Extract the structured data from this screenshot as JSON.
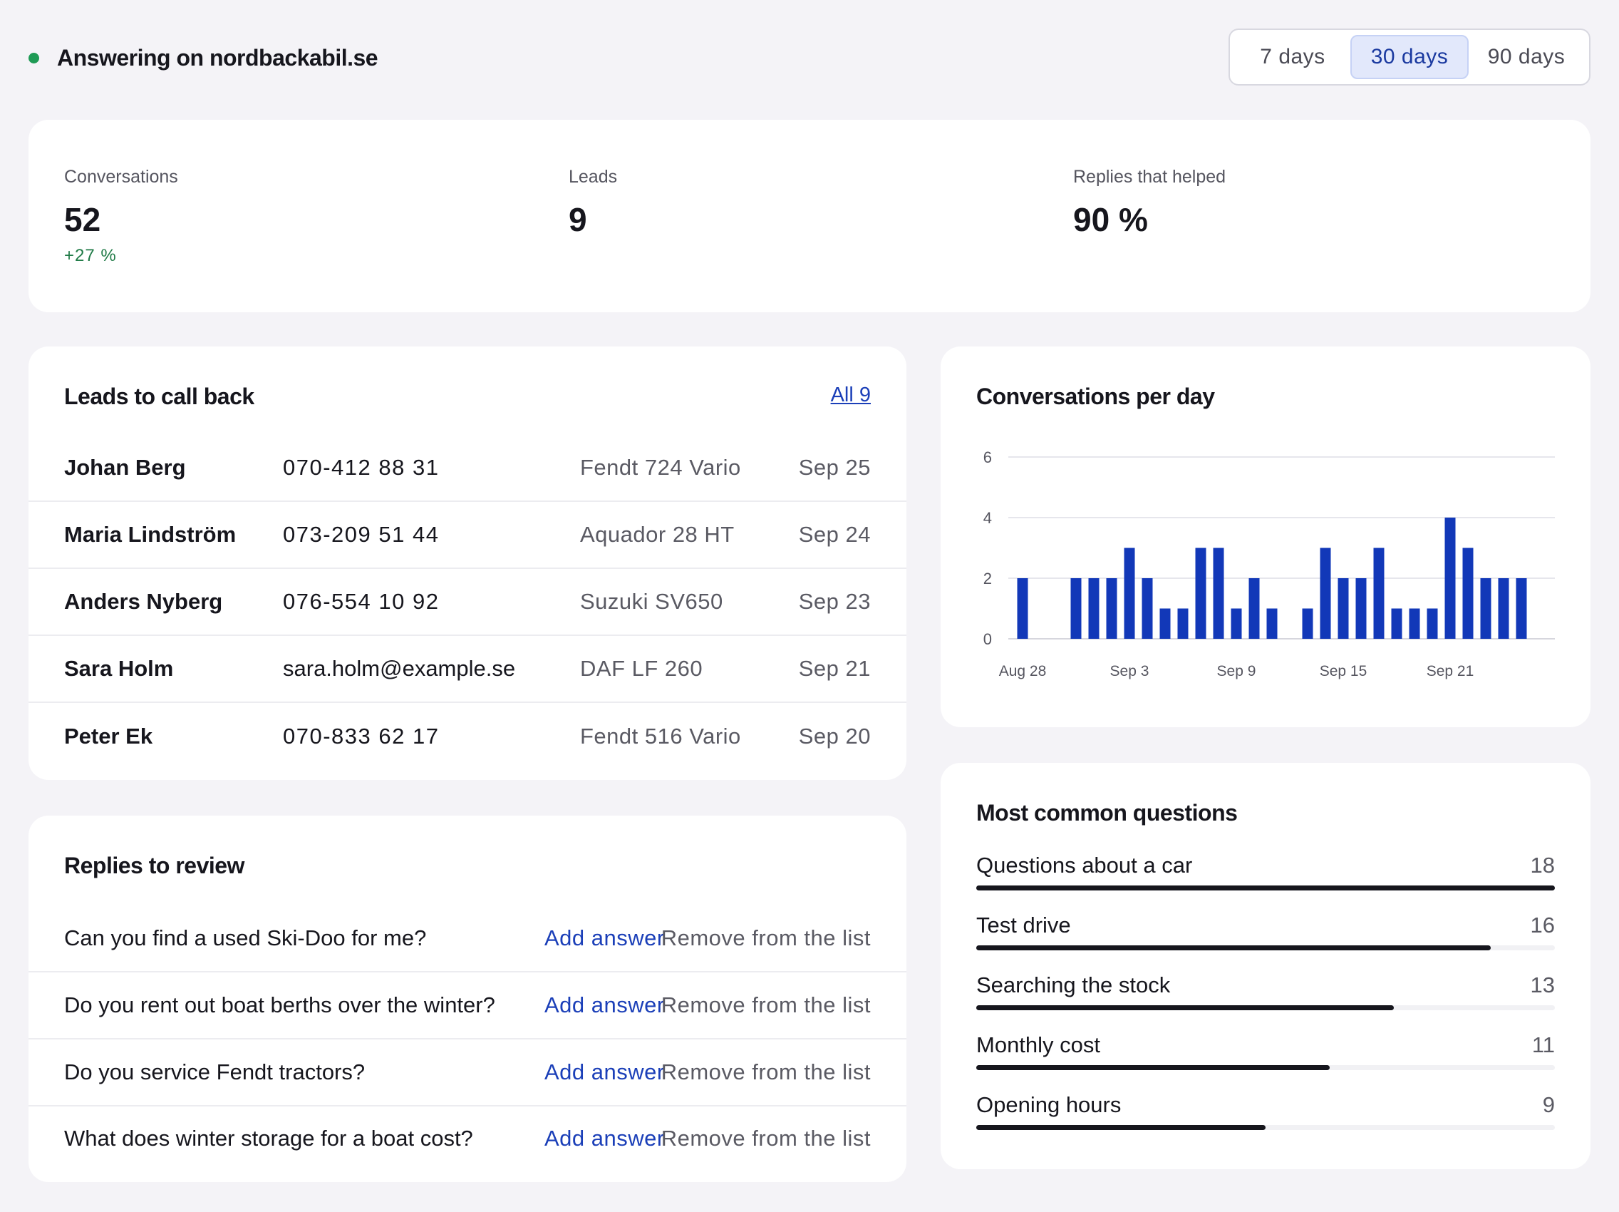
{
  "header": {
    "status_text": "Answering on nordbackabil.se",
    "ranges": [
      {
        "label": "7 days",
        "active": false
      },
      {
        "label": "30 days",
        "active": true
      },
      {
        "label": "90 days",
        "active": false
      }
    ]
  },
  "stats": [
    {
      "label": "Conversations",
      "value": "52",
      "change": "+27 %"
    },
    {
      "label": "Leads",
      "value": "9",
      "change": ""
    },
    {
      "label": "Replies that helped",
      "value": "90 %",
      "change": ""
    }
  ],
  "leads": {
    "title": "Leads to call back",
    "all_link": "All 9",
    "rows": [
      {
        "name": "Johan Berg",
        "contact": "070-412 88 31",
        "item": "Fendt 724 Vario",
        "date": "Sep 25"
      },
      {
        "name": "Maria Lindström",
        "contact": "073-209 51 44",
        "item": "Aquador 28 HT",
        "date": "Sep 24"
      },
      {
        "name": "Anders Nyberg",
        "contact": "076-554 10 92",
        "item": "Suzuki SV650",
        "date": "Sep 23"
      },
      {
        "name": "Sara Holm",
        "contact": "sara.holm@example.se",
        "item": "DAF LF 260",
        "date": "Sep 21"
      },
      {
        "name": "Peter Ek",
        "contact": "070-833 62 17",
        "item": "Fendt 516 Vario",
        "date": "Sep 20"
      }
    ]
  },
  "review": {
    "title": "Replies to review",
    "add_label": "Add answer",
    "remove_label": "Remove from the list",
    "questions": [
      "Can you find a used Ski-Doo for me?",
      "Do you rent out boat berths over the winter?",
      "Do you service Fendt tractors?",
      "What does winter storage for a boat cost?"
    ]
  },
  "chart_title": "Conversations per day",
  "chart_data": {
    "type": "bar",
    "title": "Conversations per day",
    "xlabel": "",
    "ylabel": "",
    "ylim": [
      0,
      6
    ],
    "yticks": [
      0,
      2,
      4,
      6
    ],
    "grid": true,
    "bar_color": "#1238b8",
    "categories": [
      "Aug 28",
      "Aug 29",
      "Aug 30",
      "Aug 31",
      "Sep 1",
      "Sep 2",
      "Sep 3",
      "Sep 4",
      "Sep 5",
      "Sep 6",
      "Sep 7",
      "Sep 8",
      "Sep 9",
      "Sep 10",
      "Sep 11",
      "Sep 12",
      "Sep 13",
      "Sep 14",
      "Sep 15",
      "Sep 16",
      "Sep 17",
      "Sep 18",
      "Sep 19",
      "Sep 20",
      "Sep 21",
      "Sep 22",
      "Sep 23",
      "Sep 24",
      "Sep 25",
      "Sep 26"
    ],
    "values": [
      2,
      0,
      0,
      2,
      2,
      2,
      3,
      2,
      1,
      1,
      3,
      3,
      1,
      2,
      1,
      0,
      1,
      3,
      2,
      2,
      3,
      1,
      1,
      1,
      4,
      3,
      2,
      2,
      2,
      0
    ],
    "xtick_labels": [
      "Aug 28",
      "Sep 3",
      "Sep 9",
      "Sep 15",
      "Sep 21"
    ]
  },
  "questions": {
    "title": "Most common questions",
    "items": [
      {
        "label": "Questions about a car",
        "count": 18
      },
      {
        "label": "Test drive",
        "count": 16
      },
      {
        "label": "Searching the stock",
        "count": 13
      },
      {
        "label": "Monthly cost",
        "count": 11
      },
      {
        "label": "Opening hours",
        "count": 9
      }
    ]
  }
}
